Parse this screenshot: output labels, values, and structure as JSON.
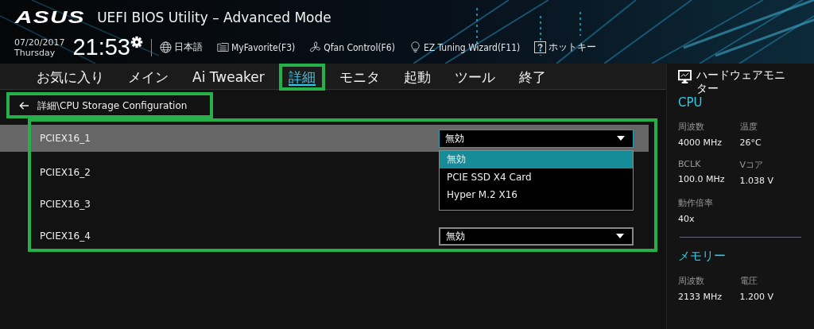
{
  "header": {
    "logo": "ASUS",
    "title": "UEFI BIOS Utility – Advanced Mode",
    "date": "07/20/2017",
    "day": "Thursday",
    "time": "21:53",
    "tools": [
      {
        "kind": "language",
        "label": "日本語"
      },
      {
        "kind": "favorite",
        "label": "MyFavorite(F3)"
      },
      {
        "kind": "fan",
        "label": "Qfan Control(F6)"
      },
      {
        "kind": "wizard",
        "label": "EZ Tuning Wizard(F11)"
      },
      {
        "kind": "help",
        "label": "ホットキー"
      }
    ]
  },
  "tabs": [
    {
      "label": "お気に入り",
      "selected": false
    },
    {
      "label": "メイン",
      "selected": false
    },
    {
      "label": "Ai Tweaker",
      "selected": false
    },
    {
      "label": "詳細",
      "selected": true
    },
    {
      "label": "モニタ",
      "selected": false
    },
    {
      "label": "起動",
      "selected": false
    },
    {
      "label": "ツール",
      "selected": false
    },
    {
      "label": "終了",
      "selected": false
    }
  ],
  "breadcrumb": "詳細\\CPU Storage Configuration",
  "settings": [
    {
      "label": "PCIEX16_1",
      "selected": true,
      "value": "無効",
      "expanded": true,
      "options": [
        {
          "label": "無効",
          "selected": true
        },
        {
          "label": "PCIE SSD X4 Card",
          "selected": false
        },
        {
          "label": "Hyper M.2 X16",
          "selected": false
        }
      ]
    },
    {
      "label": "PCIEX16_2",
      "selected": false
    },
    {
      "label": "PCIEX16_3",
      "selected": false
    },
    {
      "label": "PCIEX16_4",
      "selected": false,
      "value": "無効",
      "expanded": false
    }
  ],
  "hardware_monitor": {
    "title": "ハードウェアモニター",
    "sections": [
      {
        "title": "CPU",
        "items": [
          {
            "label": "周波数",
            "value": "4000 MHz"
          },
          {
            "label": "温度",
            "value": "26°C"
          },
          {
            "label": "BCLK",
            "value": "100.0 MHz"
          },
          {
            "label": "Vコア",
            "value": "1.038 V"
          },
          {
            "label": "動作倍率",
            "value": "40x"
          }
        ]
      },
      {
        "title": "メモリー",
        "items": [
          {
            "label": "周波数",
            "value": "2133 MHz"
          },
          {
            "label": "電圧",
            "value": "1.200 V"
          }
        ]
      }
    ]
  }
}
